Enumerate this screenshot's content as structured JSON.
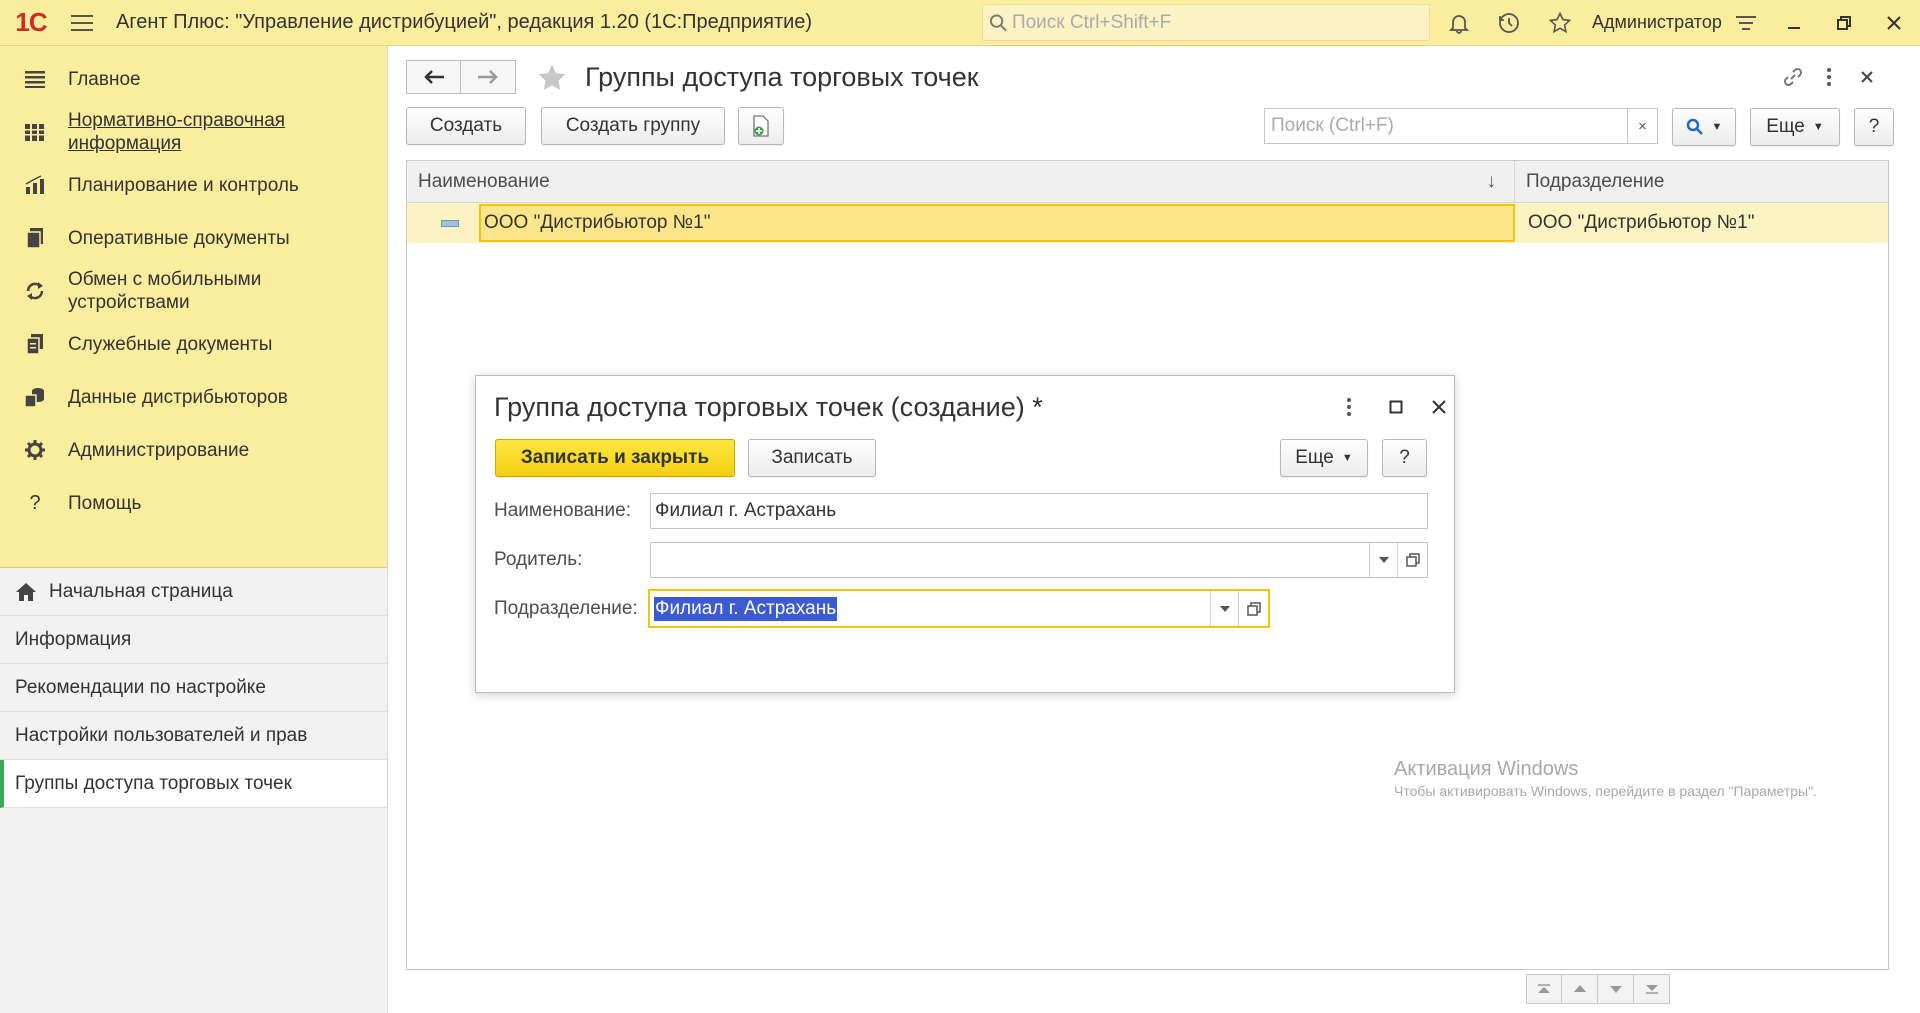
{
  "titlebar": {
    "logo": "1С",
    "app_title": "Агент Плюс: \"Управление дистрибуцией\", редакция 1.20  (1С:Предприятие)",
    "search_placeholder": "Поиск Ctrl+Shift+F",
    "user": "Администратор"
  },
  "sidebar": {
    "sections": [
      {
        "label": "Главное",
        "icon": "list-icon"
      },
      {
        "label": "Нормативно-справочная информация",
        "icon": "catalog-icon"
      },
      {
        "label": "Планирование и контроль",
        "icon": "chart-icon"
      },
      {
        "label": "Оперативные документы",
        "icon": "documents-icon"
      },
      {
        "label": "Обмен с мобильными устройствами",
        "icon": "sync-icon"
      },
      {
        "label": "Служебные документы",
        "icon": "service-docs-icon"
      },
      {
        "label": "Данные дистрибьюторов",
        "icon": "distributors-icon"
      },
      {
        "label": "Администрирование",
        "icon": "gear-icon"
      },
      {
        "label": "Помощь",
        "icon": "help-icon"
      }
    ],
    "open_windows": [
      {
        "label": "Начальная страница"
      },
      {
        "label": "Информация"
      },
      {
        "label": "Рекомендации по настройке"
      },
      {
        "label": "Настройки пользователей и прав"
      },
      {
        "label": "Группы доступа торговых точек"
      }
    ]
  },
  "main": {
    "title": "Группы доступа торговых точек",
    "toolbar": {
      "create": "Создать",
      "create_group": "Создать группу",
      "search_placeholder": "Поиск (Ctrl+F)",
      "clear": "×",
      "more": "Еще",
      "help": "?"
    },
    "grid": {
      "columns": [
        "Наименование",
        "Подразделение"
      ],
      "sort_indicator": "↓",
      "rows": [
        {
          "name": "ООО \"Дистрибьютор №1\"",
          "division": "ООО \"Дистрибьютор №1\""
        }
      ]
    },
    "watermark": {
      "line1": "Активация Windows",
      "line2": "Чтобы активировать Windows, перейдите в раздел \"Параметры\"."
    }
  },
  "dialog": {
    "title": "Группа доступа торговых точек (создание) *",
    "save_close": "Записать и закрыть",
    "save": "Записать",
    "more": "Еще",
    "help": "?",
    "fields": {
      "name_label": "Наименование:",
      "name_value": "Филиал г. Астрахань",
      "parent_label": "Родитель:",
      "parent_value": "",
      "division_label": "Подразделение:",
      "division_value": "Филиал г. Астрахань"
    }
  },
  "colors": {
    "accent_yellow": "#fbed9e",
    "primary_button": "#f4cf0f",
    "row_highlight": "#fcf3c2",
    "selection": "#3c5ad1"
  }
}
